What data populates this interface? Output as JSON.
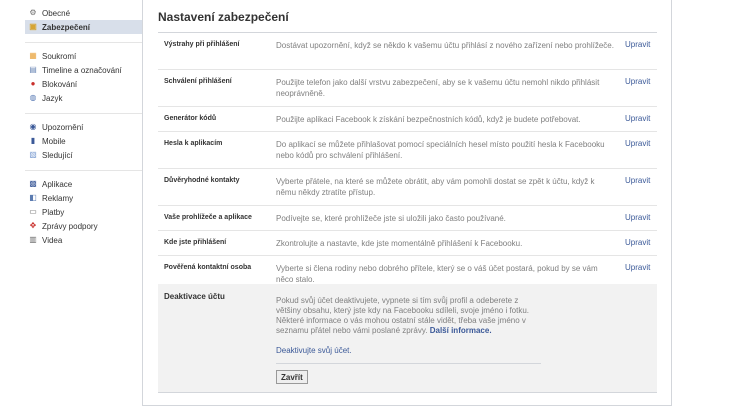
{
  "sidebar": {
    "groups": [
      [
        {
          "label": "Obecné",
          "icon": "gears-icon",
          "color": "#6d6d6d",
          "glyph": "⚙"
        },
        {
          "label": "Zabezpečení",
          "icon": "lock-icon",
          "color": "#d6a534",
          "glyph": "▣",
          "active": true
        }
      ],
      [
        {
          "label": "Soukromí",
          "icon": "privacy-icon",
          "color": "#e8a23a",
          "glyph": "▦"
        },
        {
          "label": "Timeline a označování",
          "icon": "timeline-icon",
          "color": "#6a86b5",
          "glyph": "▤"
        },
        {
          "label": "Blokování",
          "icon": "block-icon",
          "color": "#c9302c",
          "glyph": "●"
        },
        {
          "label": "Jazyk",
          "icon": "globe-icon",
          "color": "#5a7bb5",
          "glyph": "◍"
        }
      ],
      [
        {
          "label": "Upozornění",
          "icon": "notification-globe-icon",
          "color": "#3b5998",
          "glyph": "◉"
        },
        {
          "label": "Mobile",
          "icon": "mobile-icon",
          "color": "#3b5998",
          "glyph": "▮"
        },
        {
          "label": "Sledující",
          "icon": "rss-icon",
          "color": "#7a9bd0",
          "glyph": "▧"
        }
      ],
      [
        {
          "label": "Aplikace",
          "icon": "apps-icon",
          "color": "#3b5998",
          "glyph": "▩"
        },
        {
          "label": "Reklamy",
          "icon": "ads-icon",
          "color": "#5b7bb0",
          "glyph": "◧"
        },
        {
          "label": "Platby",
          "icon": "payments-icon",
          "color": "#6b6b6b",
          "glyph": "▭"
        },
        {
          "label": "Zprávy podpory",
          "icon": "support-icon",
          "color": "#c9302c",
          "glyph": "✥"
        },
        {
          "label": "Videa",
          "icon": "video-icon",
          "color": "#6b6b6b",
          "glyph": "▥"
        }
      ]
    ]
  },
  "main": {
    "title": "Nastavení zabezpečení",
    "rows": [
      {
        "label": "Výstrahy při přihlášení",
        "desc": "Dostávat upozornění, když se někdo k vašemu účtu přihlásí z nového zařízení nebo prohlížeče.",
        "action": "Upravit"
      },
      {
        "label": "Schválení přihlášení",
        "desc": "Použijte telefon jako další vrstvu zabezpečení, aby se k vašemu účtu nemohl nikdo přihlásit neoprávněně.",
        "action": "Upravit"
      },
      {
        "label": "Generátor kódů",
        "desc": "Použijte aplikaci Facebook k získání bezpečnostních kódů, když je budete potřebovat.",
        "action": "Upravit"
      },
      {
        "label": "Hesla k aplikacím",
        "desc": "Do aplikací se můžete přihlašovat pomocí speciálních hesel místo použití hesla k Facebooku nebo kódů pro schválení přihlášení.",
        "action": "Upravit"
      },
      {
        "label": "Důvěryhodné kontakty",
        "desc": "Vyberte přátele, na které se můžete obrátit, aby vám pomohli dostat se zpět k účtu, když k němu někdy ztratíte přístup.",
        "action": "Upravit"
      },
      {
        "label": "Vaše prohlížeče a aplikace",
        "desc": "Podívejte se, které prohlížeče jste si uložili jako často používané.",
        "action": "Upravit"
      },
      {
        "label": "Kde jste přihlášení",
        "desc": "Zkontrolujte a nastavte, kde jste momentálně přihlášení k Facebooku.",
        "action": "Upravit"
      },
      {
        "label": "Pověřená kontaktní osoba",
        "desc": "Vyberte si člena rodiny nebo dobrého přítele, který se o váš účet postará, pokud by se vám něco stalo.",
        "action": "Upravit"
      }
    ],
    "deactivate": {
      "label": "Deaktivace účtu",
      "text": "Pokud svůj účet deaktivujete, vypnete si tím svůj profil a odeberete z většiny obsahu, který jste kdy na Facebooku sdíleli, svoje jméno i fotku. Některé informace o vás mohou ostatní stále vidět, třeba vaše jméno v seznamu přátel nebo vámi poslané zprávy.",
      "more_link": "Další informace.",
      "deactivate_link": "Deaktivujte svůj účet.",
      "close_button": "Zavřít"
    }
  }
}
